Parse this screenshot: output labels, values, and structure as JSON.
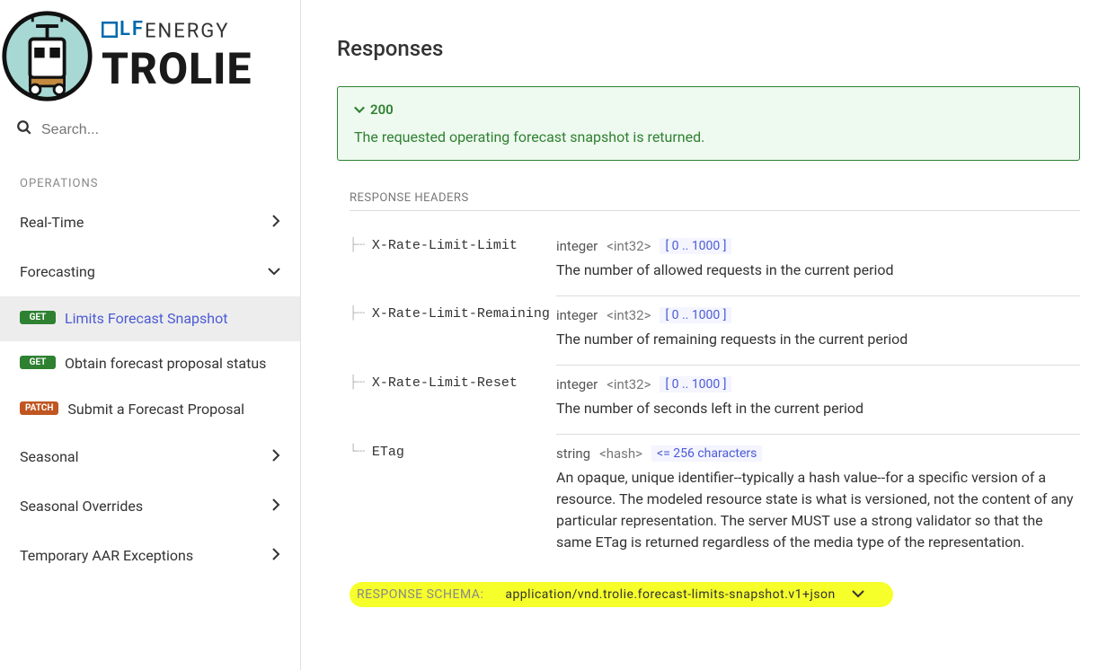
{
  "brand": {
    "prefix": "LF",
    "suffix": "ENERGY",
    "name": "TROLIE"
  },
  "search": {
    "placeholder": "Search..."
  },
  "sectionLabel": "OPERATIONS",
  "nav": {
    "items": [
      {
        "label": "Real-Time",
        "expanded": false
      },
      {
        "label": "Forecasting",
        "expanded": true
      },
      {
        "label": "Seasonal",
        "expanded": false
      },
      {
        "label": "Seasonal Overrides",
        "expanded": false
      },
      {
        "label": "Temporary AAR Exceptions",
        "expanded": false
      }
    ],
    "forecastChildren": [
      {
        "method": "GET",
        "label": "Limits Forecast Snapshot",
        "active": true
      },
      {
        "method": "GET",
        "label": "Obtain forecast proposal status",
        "active": false
      },
      {
        "method": "PATCH",
        "label": "Submit a Forecast Proposal",
        "active": false
      }
    ]
  },
  "main": {
    "title": "Responses",
    "respCode": "200",
    "respDescription": "The requested operating forecast snapshot is returned.",
    "headersLabel": "RESPONSE HEADERS",
    "headers": [
      {
        "name": "X-Rate-Limit-Limit",
        "type": "integer",
        "format": "<int32>",
        "constraint": "[ 0 .. 1000 ]",
        "desc": "The number of allowed requests in the current period"
      },
      {
        "name": "X-Rate-Limit-Remaining",
        "type": "integer",
        "format": "<int32>",
        "constraint": "[ 0 .. 1000 ]",
        "desc": "The number of remaining requests in the current period"
      },
      {
        "name": "X-Rate-Limit-Reset",
        "type": "integer",
        "format": "<int32>",
        "constraint": "[ 0 .. 1000 ]",
        "desc": "The number of seconds left in the current period"
      },
      {
        "name": "ETag",
        "type": "string",
        "format": "<hash>",
        "constraint": "<= 256 characters",
        "desc": "An opaque, unique identifier--typically a hash value--for a specific version of a resource. The modeled resource state is what is versioned, not the content of any particular representation. The server MUST use a strong validator so that the same ETag is returned regardless of the media type of the representation."
      }
    ],
    "schema": {
      "label": "RESPONSE SCHEMA:",
      "value": "application/vnd.trolie.forecast-limits-snapshot.v1+json"
    }
  }
}
